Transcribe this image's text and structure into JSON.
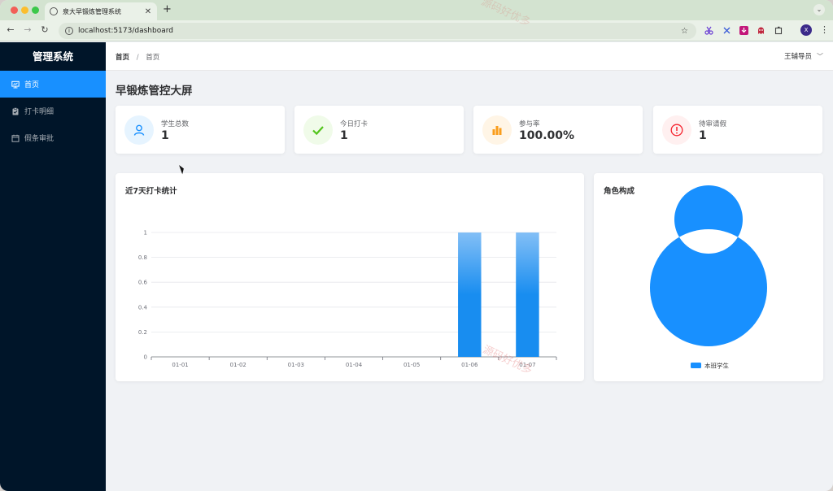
{
  "browser": {
    "tab_title": "泉大早锻炼管理系统",
    "url": "localhost:5173/dashboard"
  },
  "sidebar": {
    "title": "管理系统",
    "items": [
      {
        "label": "首页",
        "icon": "dashboard-icon",
        "active": true
      },
      {
        "label": "打卡明细",
        "icon": "clipboard-check-icon",
        "active": false
      },
      {
        "label": "假条审批",
        "icon": "calendar-icon",
        "active": false
      }
    ]
  },
  "header": {
    "breadcrumb": [
      "首页",
      "首页"
    ],
    "user": "王辅导员"
  },
  "page_title": "早锻炼管控大屏",
  "stats": [
    {
      "label": "学生总数",
      "value": "1",
      "icon": "user-icon",
      "color": "#1890ff",
      "bg": "#e6f4ff"
    },
    {
      "label": "今日打卡",
      "value": "1",
      "icon": "check-icon",
      "color": "#52c41a",
      "bg": "#f0fbe9"
    },
    {
      "label": "参与率",
      "value": "100.00%",
      "icon": "bar-chart-icon",
      "color": "#fa9d1c",
      "bg": "#fff5e6"
    },
    {
      "label": "待审请假",
      "value": "1",
      "icon": "alert-icon",
      "color": "#f5222d",
      "bg": "#fff0f0"
    }
  ],
  "panels": {
    "checkin_title": "近7天打卡统计",
    "role_title": "角色构成"
  },
  "watermark": "源码好优多",
  "chart_data": [
    {
      "type": "bar",
      "title": "近7天打卡统计",
      "categories": [
        "01-01",
        "01-02",
        "01-03",
        "01-04",
        "01-05",
        "01-06",
        "01-07"
      ],
      "values": [
        0,
        0,
        0,
        0,
        0,
        1,
        1
      ],
      "ylim": [
        0,
        1
      ],
      "yticks": [
        "0",
        "0.2",
        "0.4",
        "0.6",
        "0.8",
        "1"
      ],
      "grid": true,
      "color": "#1890ff"
    },
    {
      "type": "pie",
      "title": "角色构成",
      "donut": true,
      "slices": [
        {
          "name": "本班学生",
          "value": 1
        }
      ],
      "legend": "bottom",
      "color": "#1890ff"
    }
  ]
}
